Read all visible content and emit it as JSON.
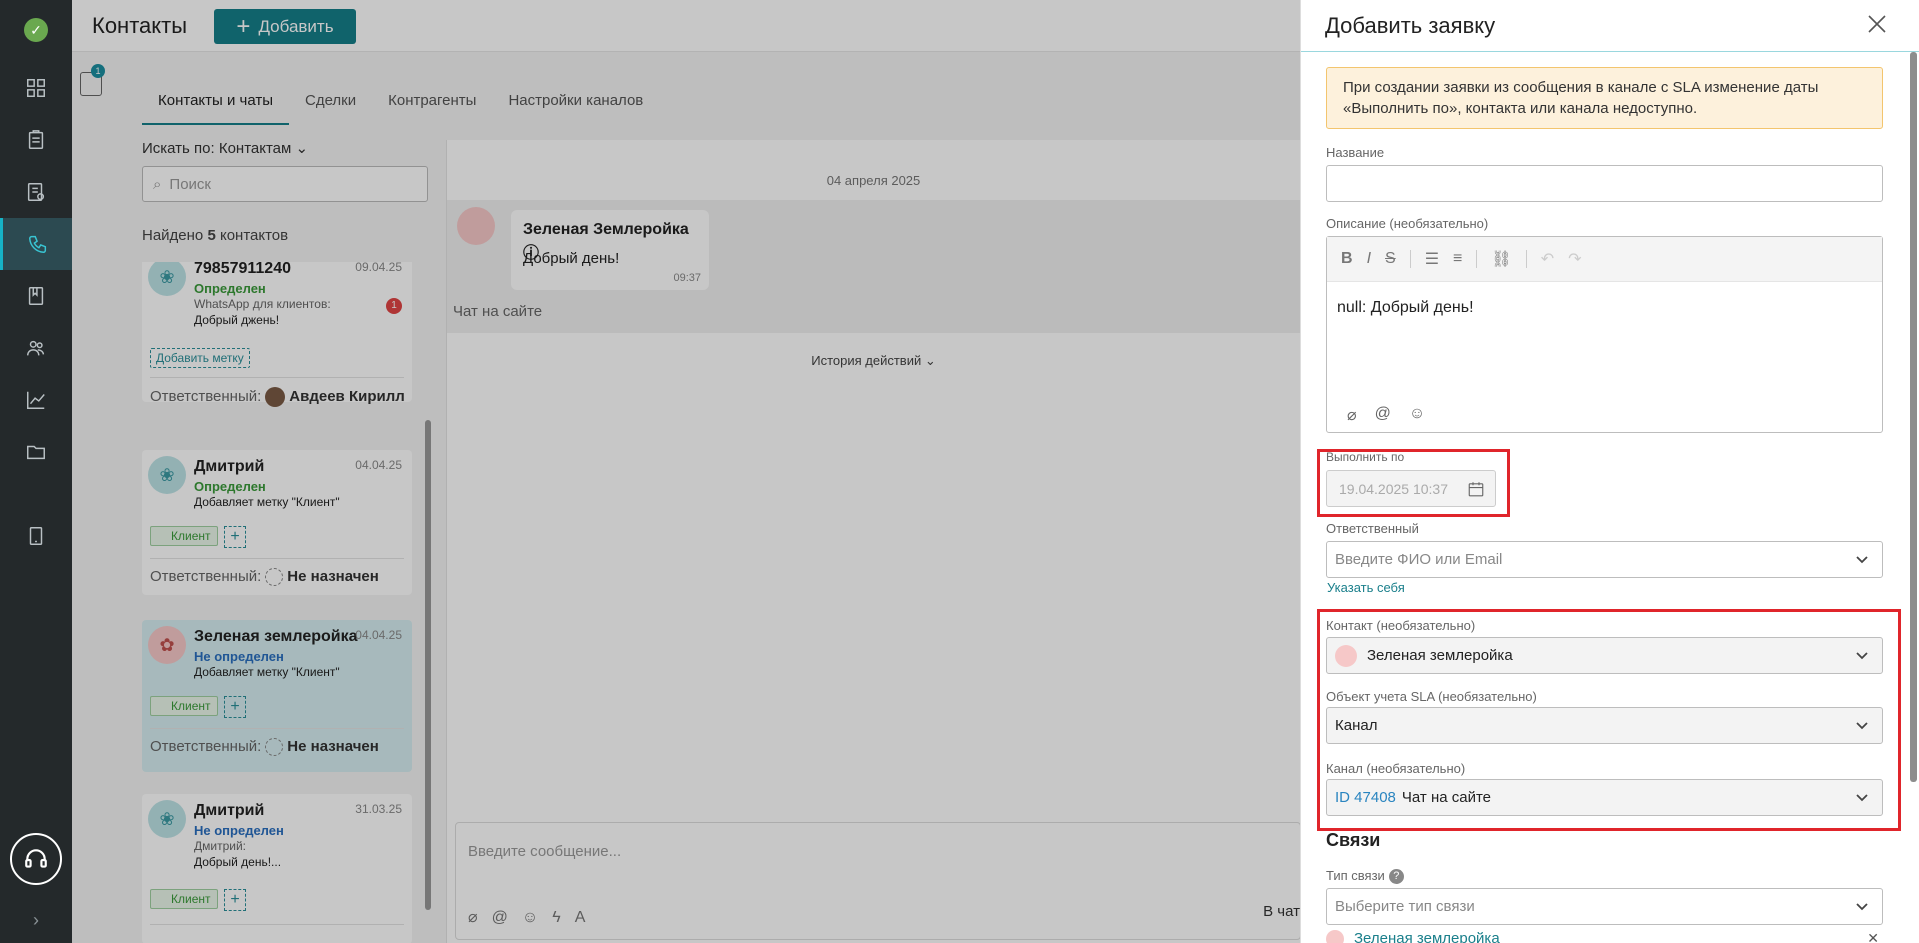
{
  "rail": {
    "items": [
      "dashboard-icon",
      "tasks-icon",
      "requests-icon",
      "contacts-icon",
      "knowledge-icon",
      "team-icon",
      "analytics-icon",
      "files-icon",
      "device-icon"
    ],
    "active": "contacts-icon",
    "support_icon": "headset-icon",
    "accent": "#16b3c6"
  },
  "header": {
    "title": "Контакты",
    "add_label": "Добавить",
    "filter_badge": "1"
  },
  "tabs": [
    "Контакты и чаты",
    "Сделки",
    "Контрагенты",
    "Настройки каналов"
  ],
  "search": {
    "by_label": "Искать по: Контактам",
    "placeholder": "Поиск"
  },
  "found": {
    "prefix": "Найдено",
    "count": "5",
    "suffix": "контактов"
  },
  "contacts": [
    {
      "name": "79857911240",
      "date": "09.04.25",
      "status": "Определен",
      "line1": "WhatsApp для клиентов:",
      "line2": "Добрый джень!",
      "unread": "1",
      "tag_add": "Добавить метку",
      "resp_label": "Ответственный:",
      "resp_name": "Авдеев Кирилл"
    },
    {
      "name": "Дмитрий",
      "date": "04.04.25",
      "status": "Определен",
      "line1": "Добавляет метку \"Клиент\"",
      "tag": "Клиент",
      "resp_label": "Ответственный:",
      "resp_name": "Не назначен"
    },
    {
      "name": "Зеленая землеройка",
      "date": "04.04.25",
      "status": "Не определен",
      "line1": "Добавляет метку \"Клиент\"",
      "tag": "Клиент",
      "resp_label": "Ответственный:",
      "resp_name": "Не назначен"
    },
    {
      "name": "Дмитрий",
      "date": "31.03.25",
      "status": "Не определен",
      "line1": "Дмитрий:",
      "line2": "Добрый день!...",
      "tag": "Клиент"
    }
  ],
  "chat": {
    "day": "04 апреля 2025",
    "sender": "Зеленая Землеройка",
    "text": "Добрый день!",
    "time": "09:37",
    "channel": "Чат на сайте",
    "history": "История действий",
    "composer_placeholder": "Введите сообщение...",
    "composer_channel": "В чат"
  },
  "drawer": {
    "title": "Добавить заявку",
    "warning": "При создании заявки из сообщения в канале с SLA изменение даты «Выполнить по», контакта или канала недоступно.",
    "name_label": "Название",
    "name_value": "",
    "desc_label": "Описание (необязательно)",
    "desc_value": "null: Добрый день!",
    "due_label": "Выполнить по",
    "due_value": "19.04.2025 10:37",
    "assignee_label": "Ответственный",
    "assignee_placeholder": "Введите ФИО или Email",
    "assign_self": "Указать себя",
    "contact_label": "Контакт (необязательно)",
    "contact_value": "Зеленая землеройка",
    "sla_label": "Объект учета SLA (необязательно)",
    "sla_value": "Канал",
    "channel_label": "Канал (необязательно)",
    "channel_id": "ID 47408",
    "channel_value": "Чат на сайте",
    "links_title": "Связи",
    "link_type_label": "Тип связи",
    "link_type_placeholder": "Выберите тип связи",
    "linked_item": "Зеленая землеройка",
    "highlight_color": "#e0252b"
  }
}
